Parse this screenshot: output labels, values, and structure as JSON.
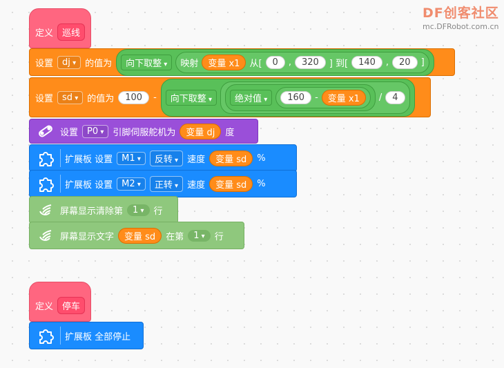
{
  "logo": {
    "brand": "DF创客社区",
    "url": "mc.DFRobot.com.cn"
  },
  "func1": {
    "define": "定义",
    "name": "巡线"
  },
  "b1": {
    "set": "设置",
    "var": "dj",
    "valueof": "的值为",
    "round_op": "向下取整",
    "map": "映射",
    "var_x1": "变量 x1",
    "from": "从[",
    "a": "0",
    "b": "320",
    "to": "] 到[",
    "c": "140",
    "d": "20",
    "close": "]"
  },
  "b2": {
    "set": "设置",
    "var": "sd",
    "valueof": "的值为",
    "n100": "100",
    "minus": "-",
    "round_op": "向下取整",
    "abs": "绝对值",
    "n160": "160",
    "minus2": "-",
    "var_x1": "变量 x1",
    "div": "/",
    "n4": "4"
  },
  "b3": {
    "set": "设置",
    "pin": "P0",
    "servo": "引脚伺服舵机为",
    "var_dj": "变量 dj",
    "deg": "度"
  },
  "b4": {
    "label": "扩展板 设置",
    "motor": "M1",
    "dir": "反转",
    "speed": "速度",
    "var_sd": "变量 sd",
    "pct": "%"
  },
  "b5": {
    "label": "扩展板 设置",
    "motor": "M2",
    "dir": "正转",
    "speed": "速度",
    "var_sd": "变量 sd",
    "pct": "%"
  },
  "b6": {
    "label": "屏幕显示清除第",
    "line": "1",
    "row": "行"
  },
  "b7": {
    "label": "屏幕显示文字",
    "var_sd": "变量 sd",
    "at": "在第",
    "line": "1",
    "row": "行"
  },
  "func2": {
    "define": "定义",
    "name": "停车"
  },
  "b8": {
    "label": "扩展板 全部停止"
  }
}
